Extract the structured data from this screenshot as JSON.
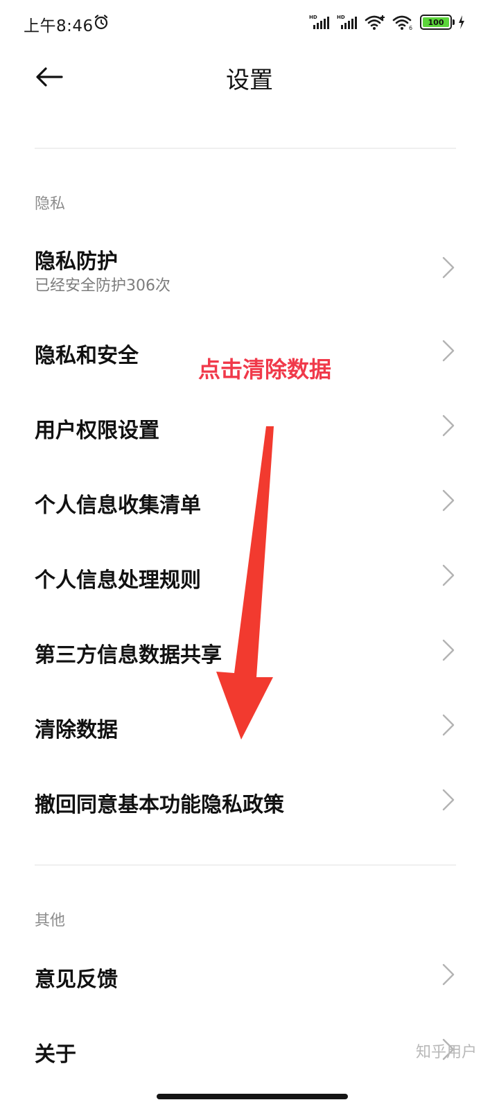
{
  "status_bar": {
    "time": "上午8:46",
    "icons": [
      "alarm-icon",
      "hd-signal-icon",
      "hd-signal-icon",
      "wifi-icon",
      "wifi-icon",
      "battery-icon",
      "charging-icon"
    ],
    "battery_label": "100",
    "battery_level": 1.0,
    "battery_color": "#5bd43a"
  },
  "header": {
    "back_icon": "arrow-left-icon",
    "title": "设置"
  },
  "sections": [
    {
      "header": "隐私",
      "items": [
        {
          "title": "隐私防护",
          "subtitle": "已经安全防护306次"
        },
        {
          "title": "隐私和安全"
        },
        {
          "title": "用户权限设置"
        },
        {
          "title": "个人信息收集清单"
        },
        {
          "title": "个人信息处理规则"
        },
        {
          "title": "第三方信息数据共享"
        },
        {
          "title": "清除数据"
        },
        {
          "title": "撤回同意基本功能隐私政策"
        }
      ]
    },
    {
      "header": "其他",
      "items": [
        {
          "title": "意见反馈"
        },
        {
          "title": "关于"
        }
      ]
    }
  ],
  "annotation": {
    "text": "点击清除数据",
    "color": "#f0394a",
    "arrow_color": "#f23a2f"
  },
  "watermark": "知乎用户",
  "colors": {
    "background": "#ffffff",
    "text_primary": "#111111",
    "text_secondary": "#7c7c7c",
    "divider": "#efefef"
  }
}
